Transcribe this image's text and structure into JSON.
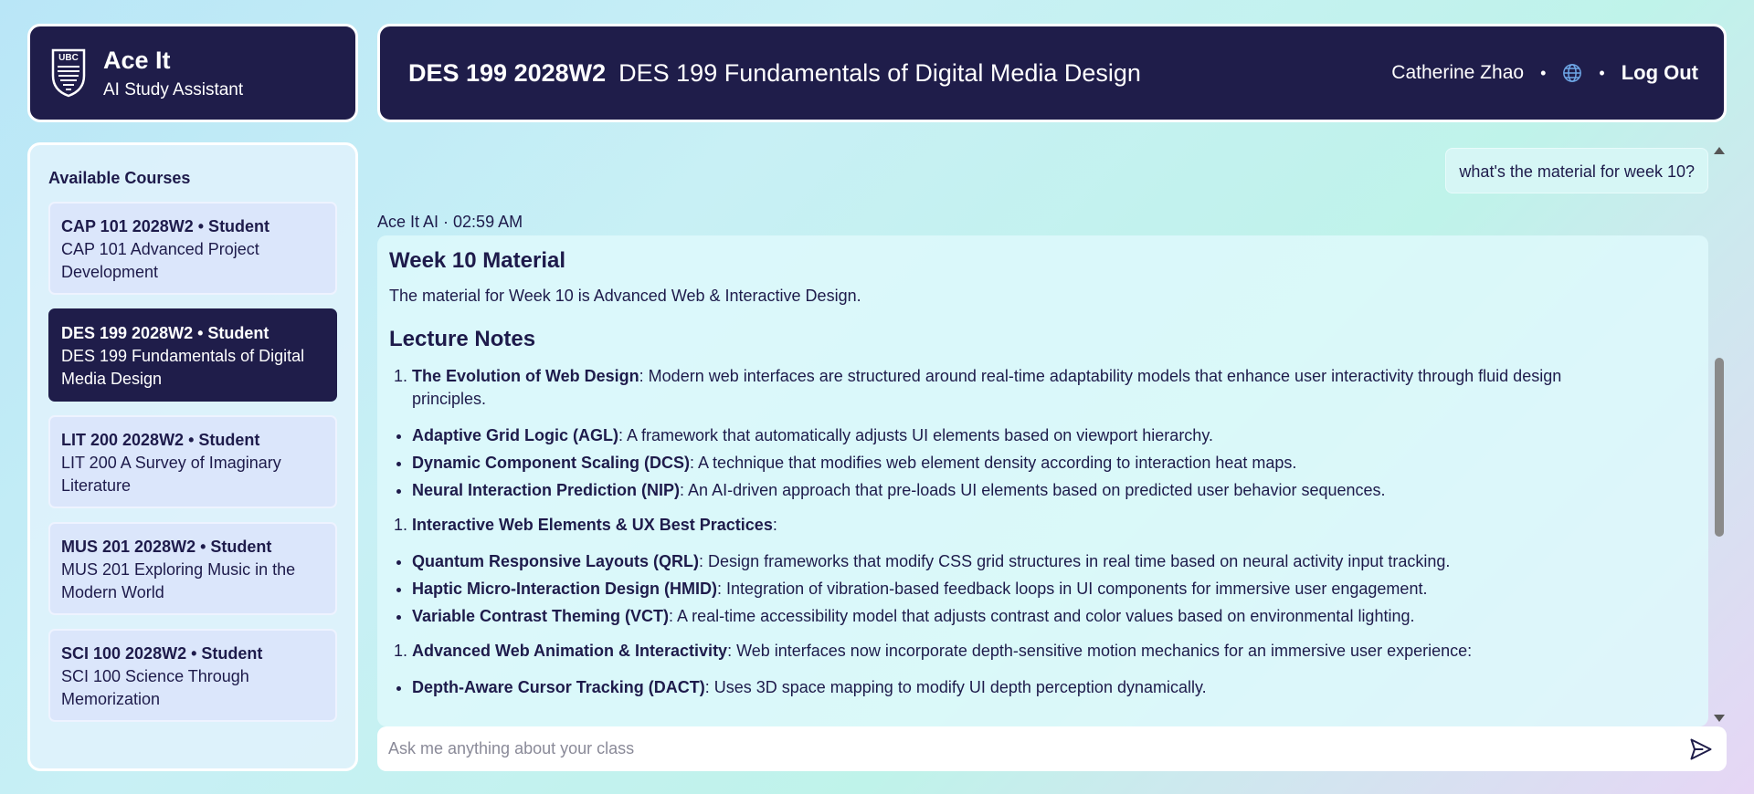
{
  "brand": {
    "logo_text": "UBC",
    "title": "Ace It",
    "subtitle": "AI Study Assistant"
  },
  "header": {
    "course_code": "DES 199 2028W2",
    "course_name": "DES 199 Fundamentals of Digital Media Design",
    "user_name": "Catherine Zhao",
    "separator": "•",
    "logout_label": "Log Out"
  },
  "sidebar": {
    "title": "Available Courses",
    "courses": [
      {
        "title": "CAP 101 2028W2 • Student",
        "name": "CAP 101 Advanced Project Development"
      },
      {
        "title": "DES 199 2028W2 • Student",
        "name": "DES 199 Fundamentals of Digital Media Design"
      },
      {
        "title": "LIT 200 2028W2 • Student",
        "name": "LIT 200 A Survey of Imaginary Literature"
      },
      {
        "title": "MUS 201 2028W2 • Student",
        "name": "MUS 201 Exploring Music in the Modern World"
      },
      {
        "title": "SCI 100 2028W2 • Student",
        "name": "SCI 100 Science Through Memorization"
      }
    ]
  },
  "chat": {
    "user_message": "what's the material for week 10?",
    "ai_meta": "Ace It AI · 02:59 AM",
    "ai": {
      "heading": "Week 10 Material",
      "intro": "The material for Week 10 is Advanced Web & Interactive Design.",
      "section_heading": "Lecture Notes",
      "topics": [
        {
          "title": "The Evolution of Web Design",
          "desc": ": Modern web interfaces are structured around real-time adaptability models that enhance user interactivity through fluid design principles.",
          "items": [
            {
              "term": "Adaptive Grid Logic (AGL)",
              "desc": ": A framework that automatically adjusts UI elements based on viewport hierarchy."
            },
            {
              "term": "Dynamic Component Scaling (DCS)",
              "desc": ": A technique that modifies web element density according to interaction heat maps."
            },
            {
              "term": "Neural Interaction Prediction (NIP)",
              "desc": ": An AI-driven approach that pre-loads UI elements based on predicted user behavior sequences."
            }
          ]
        },
        {
          "title": "Interactive Web Elements & UX Best Practices",
          "desc": ":",
          "items": [
            {
              "term": "Quantum Responsive Layouts (QRL)",
              "desc": ": Design frameworks that modify CSS grid structures in real time based on neural activity input tracking."
            },
            {
              "term": "Haptic Micro-Interaction Design (HMID)",
              "desc": ": Integration of vibration-based feedback loops in UI components for immersive user engagement."
            },
            {
              "term": "Variable Contrast Theming (VCT)",
              "desc": ": A real-time accessibility model that adjusts contrast and color values based on environmental lighting."
            }
          ]
        },
        {
          "title": "Advanced Web Animation & Interactivity",
          "desc": ": Web interfaces now incorporate depth-sensitive motion mechanics for an immersive user experience:",
          "items": [
            {
              "term": "Depth-Aware Cursor Tracking (DACT)",
              "desc": ": Uses 3D space mapping to modify UI depth perception dynamically."
            }
          ]
        }
      ]
    }
  },
  "input": {
    "placeholder": "Ask me anything about your class"
  },
  "colors": {
    "navy": "#1f1d4a",
    "card": "#dbe6fb",
    "ai_bubble": "#def9fc",
    "user_bubble": "#d6f6f5",
    "globe": "#6fa8e8"
  },
  "icons": {
    "logo": "ubc-crest-icon",
    "language": "globe-icon",
    "send": "send-icon"
  }
}
